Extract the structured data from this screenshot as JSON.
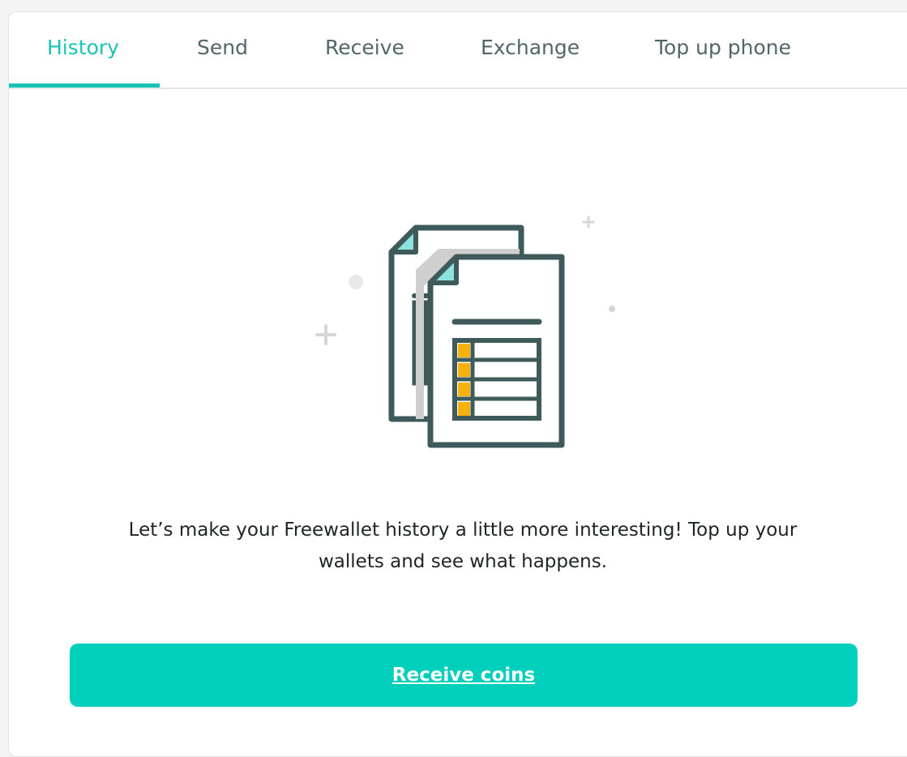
{
  "tabs": [
    {
      "label": "History",
      "active": true
    },
    {
      "label": "Send",
      "active": false
    },
    {
      "label": "Receive",
      "active": false
    },
    {
      "label": "Exchange",
      "active": false
    },
    {
      "label": "Top up phone",
      "active": false
    }
  ],
  "empty_state": {
    "illustration_icon": "documents-table-icon",
    "message_line1": "Let’s make your Freewallet history a little more interesting! Top up your",
    "message_line2": "wallets and see what happens."
  },
  "cta": {
    "label": "Receive coins"
  },
  "colors": {
    "accent": "#18c4b3",
    "button": "#00cfbc",
    "tab_text": "#52666a",
    "icon_stroke": "#3f5a5b",
    "icon_accent": "#f5b20f",
    "icon_light": "#8be3dc"
  }
}
